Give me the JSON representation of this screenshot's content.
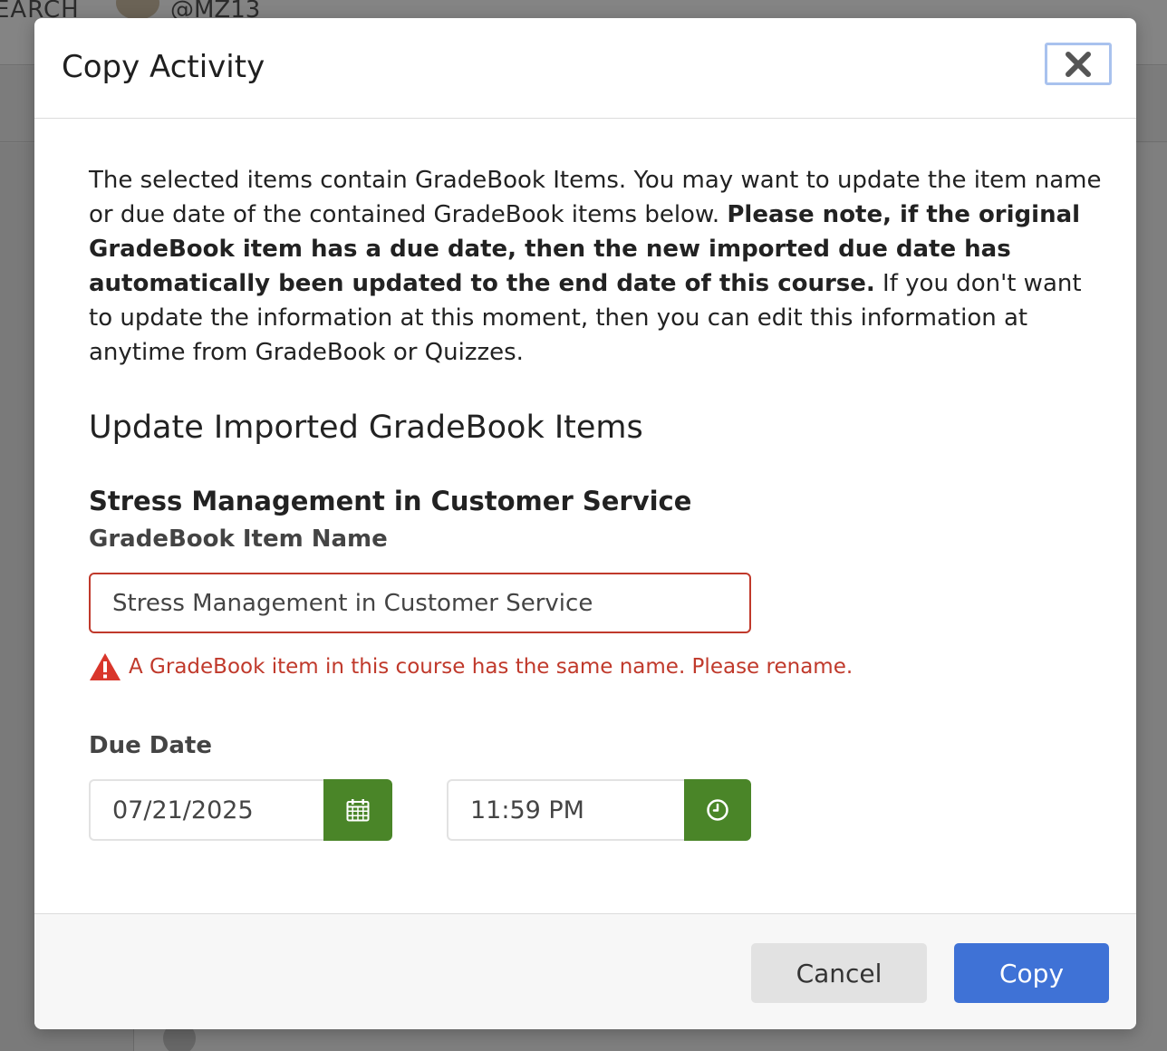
{
  "background": {
    "search_text": "EARCH",
    "username": "@MZ13"
  },
  "modal": {
    "title": "Copy Activity",
    "close_icon": "close-x-icon",
    "intro_part1": "The selected items contain GradeBook Items. You may want to update the item name or due date of the contained GradeBook items below. ",
    "intro_bold": "Please note, if the original GradeBook item has a due date, then the new imported due date has automatically been updated to the end date of this course.",
    "intro_part2": " If you don't want to update the information at this moment, then you can edit this information at anytime from GradeBook or Quizzes.",
    "section_heading": "Update Imported GradeBook Items",
    "item_title": "Stress Management in Customer Service",
    "name_label": "GradeBook Item Name",
    "name_value": "Stress Management in Customer Service",
    "error_icon": "warning-triangle-icon",
    "error_text": "A GradeBook item in this course has the same name. Please rename.",
    "due_date_label": "Due Date",
    "date_value": "07/21/2025",
    "date_icon": "calendar-icon",
    "time_value": "11:59 PM",
    "time_icon": "clock-icon"
  },
  "footer": {
    "cancel_label": "Cancel",
    "copy_label": "Copy"
  },
  "colors": {
    "error": "#c0392b",
    "addon_green": "#4a8528",
    "primary_blue": "#3f72d6"
  }
}
